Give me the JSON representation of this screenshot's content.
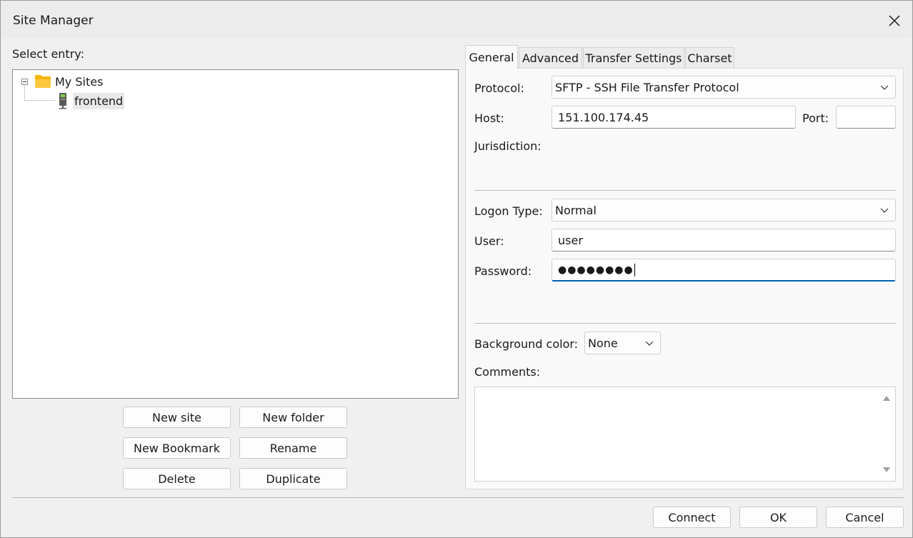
{
  "window": {
    "title": "Site Manager"
  },
  "left": {
    "select_entry_label": "Select entry:",
    "tree": [
      {
        "label": "My Sites",
        "type": "folder",
        "expanded": true
      },
      {
        "label": "frontend",
        "type": "site",
        "selected": true
      }
    ],
    "buttons": {
      "new_site": "New site",
      "new_folder": "New folder",
      "new_bookmark": "New Bookmark",
      "rename": "Rename",
      "delete": "Delete",
      "duplicate": "Duplicate"
    }
  },
  "tabs": [
    {
      "label": "General",
      "active": true
    },
    {
      "label": "Advanced",
      "active": false
    },
    {
      "label": "Transfer Settings",
      "active": false
    },
    {
      "label": "Charset",
      "active": false
    }
  ],
  "general": {
    "protocol_label": "Protocol:",
    "protocol_value": "SFTP - SSH File Transfer Protocol",
    "host_label": "Host:",
    "host_value": "151.100.174.45",
    "port_label": "Port:",
    "port_value": "",
    "jurisdiction_label": "Jurisdiction:",
    "logon_type_label": "Logon Type:",
    "logon_type_value": "Normal",
    "user_label": "User:",
    "user_value": "user",
    "password_label": "Password:",
    "password_value": "●●●●●●●●",
    "bg_color_label": "Background color:",
    "bg_color_value": "None",
    "comments_label": "Comments:",
    "comments_value": ""
  },
  "footer": {
    "connect": "Connect",
    "ok": "OK",
    "cancel": "Cancel"
  },
  "colors": {
    "accent": "#005fb8",
    "folder": "#f4b400",
    "background": "#f0f0f0"
  }
}
